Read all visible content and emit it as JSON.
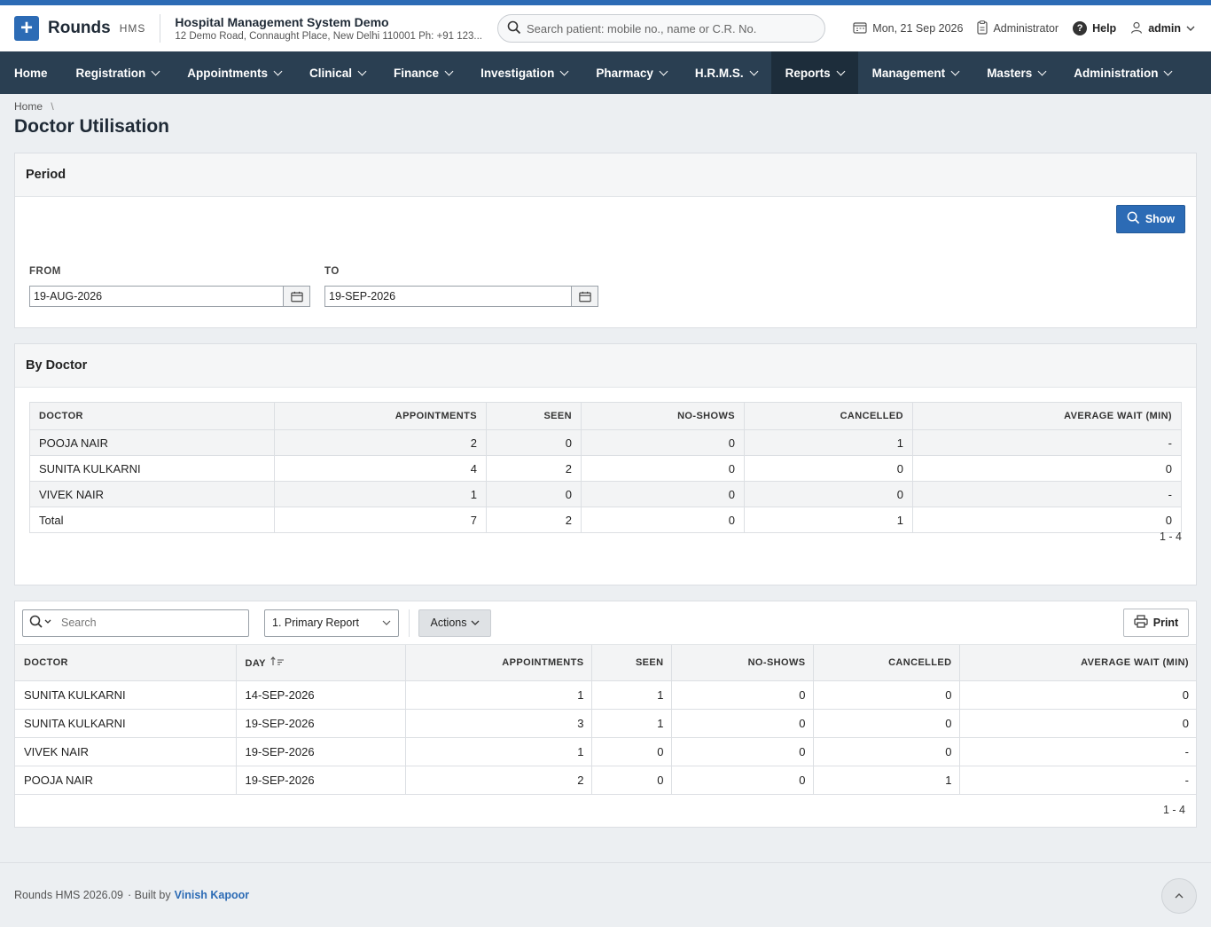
{
  "header": {
    "brand": "Rounds",
    "brand_sub": "HMS",
    "org_name": "Hospital Management System Demo",
    "org_address": "12 Demo Road, Connaught Place, New Delhi 110001 Ph: +91 123...",
    "search_placeholder": "Search patient: mobile no., name or C.R. No.",
    "date": "Mon, 21 Sep 2026",
    "role": "Administrator",
    "help": "Help",
    "user": "admin"
  },
  "nav": [
    {
      "label": "Home",
      "caret": false,
      "active": false
    },
    {
      "label": "Registration",
      "caret": true,
      "active": false
    },
    {
      "label": "Appointments",
      "caret": true,
      "active": false
    },
    {
      "label": "Clinical",
      "caret": true,
      "active": false
    },
    {
      "label": "Finance",
      "caret": true,
      "active": false
    },
    {
      "label": "Investigation",
      "caret": true,
      "active": false
    },
    {
      "label": "Pharmacy",
      "caret": true,
      "active": false
    },
    {
      "label": "H.R.M.S.",
      "caret": true,
      "active": false
    },
    {
      "label": "Reports",
      "caret": true,
      "active": true
    },
    {
      "label": "Management",
      "caret": true,
      "active": false
    },
    {
      "label": "Masters",
      "caret": true,
      "active": false
    },
    {
      "label": "Administration",
      "caret": true,
      "active": false
    }
  ],
  "breadcrumb": {
    "home": "Home",
    "sep": "\\"
  },
  "page_title": "Doctor Utilisation",
  "period": {
    "title": "Period",
    "show_label": "Show",
    "from_label": "FROM",
    "from_value": "19-AUG-2026",
    "to_label": "TO",
    "to_value": "19-SEP-2026"
  },
  "by_doctor": {
    "title": "By Doctor",
    "columns": [
      "DOCTOR",
      "APPOINTMENTS",
      "SEEN",
      "NO-SHOWS",
      "CANCELLED",
      "AVERAGE WAIT (MIN)"
    ],
    "rows": [
      [
        "POOJA NAIR",
        "2",
        "0",
        "0",
        "1",
        "-"
      ],
      [
        "SUNITA KULKARNI",
        "4",
        "2",
        "0",
        "0",
        "0"
      ],
      [
        "VIVEK NAIR",
        "1",
        "0",
        "0",
        "0",
        "-"
      ],
      [
        "Total",
        "7",
        "2",
        "0",
        "1",
        "0"
      ]
    ],
    "pagination": "1 - 4"
  },
  "report": {
    "search_placeholder": "Search",
    "report_select": "1. Primary Report",
    "actions_label": "Actions",
    "print_label": "Print",
    "columns": [
      "DOCTOR",
      "DAY",
      "APPOINTMENTS",
      "SEEN",
      "NO-SHOWS",
      "CANCELLED",
      "AVERAGE WAIT (MIN)"
    ],
    "rows": [
      [
        "SUNITA KULKARNI",
        "14-SEP-2026",
        "1",
        "1",
        "0",
        "0",
        "0"
      ],
      [
        "SUNITA KULKARNI",
        "19-SEP-2026",
        "3",
        "1",
        "0",
        "0",
        "0"
      ],
      [
        "VIVEK NAIR",
        "19-SEP-2026",
        "1",
        "0",
        "0",
        "0",
        "-"
      ],
      [
        "POOJA NAIR",
        "19-SEP-2026",
        "2",
        "0",
        "0",
        "1",
        "-"
      ]
    ],
    "pagination": "1 - 4"
  },
  "footer": {
    "version": "Rounds HMS 2026.09",
    "built_by": "· Built by",
    "author": "Vinish Kapoor"
  }
}
